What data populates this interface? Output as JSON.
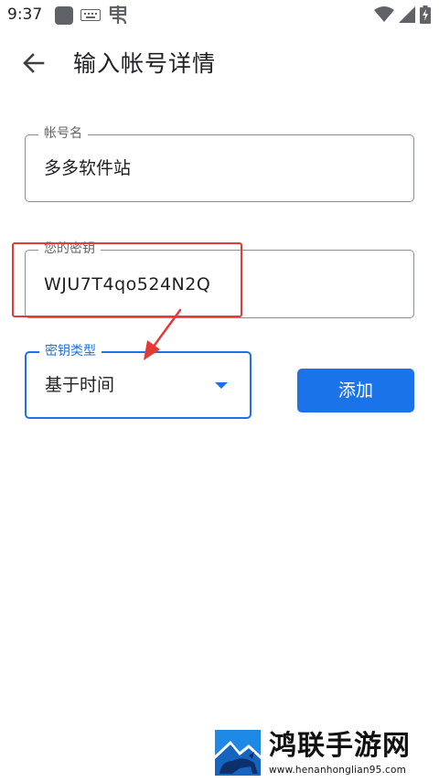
{
  "status_bar": {
    "time": "9:37",
    "icons": [
      "app-square-icon",
      "keyboard-icon",
      "bug-icon",
      "wifi-icon",
      "signal-icon",
      "battery-charging-icon"
    ]
  },
  "app_bar": {
    "back_icon": "arrow-left-icon",
    "title": "输入帐号详情"
  },
  "form": {
    "account": {
      "label": "帐号名",
      "value": "多多软件站"
    },
    "key": {
      "label": "您的密钥",
      "value": "WJU7T4qo524N2Q"
    },
    "key_type": {
      "label": "密钥类型",
      "value": "基于时间",
      "dropdown_icon": "arrow-drop-down-icon"
    },
    "add_label": "添加"
  },
  "watermark": {
    "title": "鸿联手游网",
    "url": "www.henanhonglian95.com"
  },
  "colors": {
    "accent": "#1a73e8",
    "annotation": "#e53935",
    "outline": "#8a8d91",
    "text": "#202124"
  }
}
